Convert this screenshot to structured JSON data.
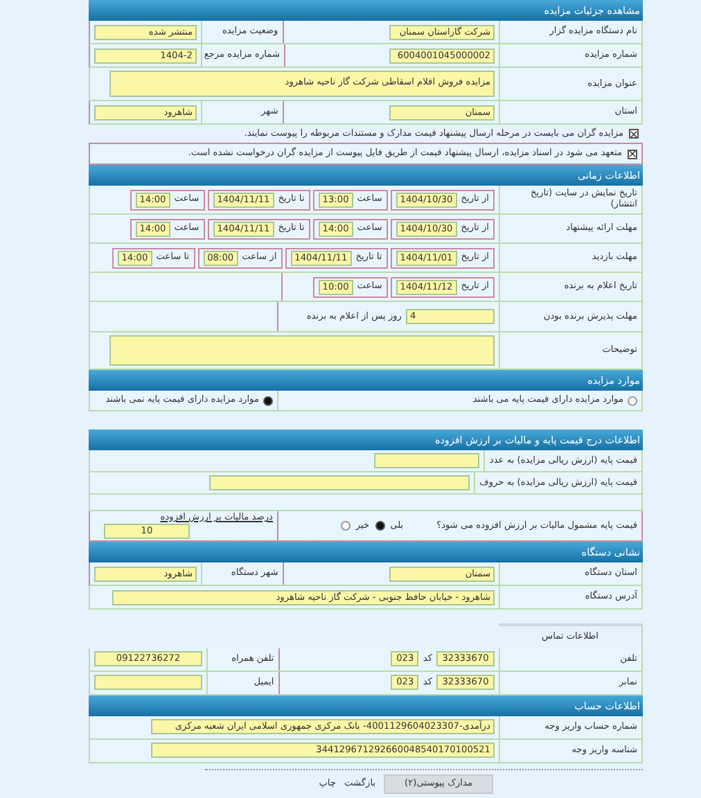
{
  "sections": [
    {
      "kind": "header",
      "title": "مشاهده جزئیات مزایده"
    },
    {
      "kind": "pair",
      "label": "نام دستگاه مزایده گزار",
      "value": "شرکت گازاستان سمنان",
      "label2": "وضعیت مزایده",
      "value2": "منتشر شده"
    },
    {
      "kind": "pair",
      "label": "شماره مزایده",
      "value": "6004001045000002",
      "label2": "شماره مزایده مرجع",
      "value2": "1404-2"
    },
    {
      "kind": "wide",
      "label": "عنوان مزایده",
      "value": "مزایده فروش اقلام اسقاطی شرکت گاز ناحیه شاهرود"
    },
    {
      "kind": "pair",
      "label": "استان",
      "value": "سمنان",
      "label2": "شهر",
      "value2": "شاهرود"
    },
    {
      "kind": "check",
      "checked": true,
      "text": "مزایده گران می بایست در مرحله ارسال پیشنهاد قیمت مدارک و مستندات مربوطه را پیوست نمایند."
    },
    {
      "kind": "note",
      "checked": true,
      "text": "متعهد می شود در اسناد مزایده، ارسال پیشنهاد قیمت از طریق فایل پیوست از مزایده گران درخواست نشده است."
    },
    {
      "kind": "header",
      "title": "اطلاعات زمانی"
    },
    {
      "kind": "times",
      "label": "تاریخ نمایش در سایت (تاریخ انتشار)",
      "items": [
        {
          "label": "از تاریخ",
          "value": "1404/10/30"
        },
        {
          "label": "ساعت",
          "value": "13:00"
        },
        {
          "label": "تا تاریخ",
          "value": "1404/11/11"
        },
        {
          "label": "ساعت",
          "value": "14:00"
        }
      ]
    },
    {
      "kind": "times",
      "label": "مهلت ارائه پیشنهاد",
      "items": [
        {
          "label": "از تاریخ",
          "value": "1404/10/30"
        },
        {
          "label": "ساعت",
          "value": "14:00"
        },
        {
          "label": "تا تاریخ",
          "value": "1404/11/11"
        },
        {
          "label": "ساعت",
          "value": "14:00"
        }
      ]
    },
    {
      "kind": "times",
      "label": "مهلت بازدید",
      "items": [
        {
          "label": "از تاریخ",
          "value": "1404/11/01"
        },
        {
          "label": "تا تاریخ",
          "value": "1404/11/11"
        },
        {
          "label": "از ساعت",
          "value": "08:00"
        },
        {
          "label": "تا ساعت",
          "value": "14:00"
        }
      ]
    },
    {
      "kind": "announce",
      "label": "تاریخ اعلام به برنده",
      "items": [
        {
          "label": "از تاریخ",
          "value": "1404/11/12"
        },
        {
          "label": "ساعت",
          "value": "10:00"
        }
      ]
    },
    {
      "kind": "days",
      "label": "مهلت پذیرش برنده بودن",
      "value": "4",
      "suffix": "روز پس از اعلام به برنده"
    },
    {
      "kind": "wide",
      "label": "توضیحات"
    },
    {
      "kind": "header",
      "title": "موارد مزایده"
    },
    {
      "kind": "radios",
      "options": [
        {
          "text": "موارد مزایده دارای قیمت پایه می باشند",
          "selected": false
        },
        {
          "text": "موارد مزایده دارای قیمت پایه نمی باشند",
          "selected": true
        }
      ]
    },
    {
      "kind": "header",
      "title": "اطلاعات درج قیمت پایه و مالیات بر ارزش افزوده"
    },
    {
      "kind": "short",
      "label": "قیمت پایه (ارزش ریالی مزایده) به عدد"
    },
    {
      "kind": "long",
      "label": "قیمت پایه (ارزش ریالی مزایده) به حروف"
    },
    {
      "kind": "vat",
      "label": "قیمت پایه مشمول مالیات بر ارزش افزوده می شود؟",
      "options": [
        {
          "text": "بلی",
          "selected": true
        },
        {
          "text": "خیر",
          "selected": false
        }
      ],
      "rate_label": "درصد مالیات بر ارزش افزوده",
      "rate": "10"
    },
    {
      "kind": "header",
      "title": "نشانی دستگاه"
    },
    {
      "kind": "pair",
      "label": "استان دستگاه",
      "value": "سمنان",
      "label2": "شهر دستگاه",
      "value2": "شاهرود"
    },
    {
      "kind": "wide",
      "label": "آدرس دستگاه",
      "value": "شاهرود - خیابان حافظ جنوبی - شرکت گاز ناحیه شاهرود"
    },
    {
      "kind": "subhead",
      "title": "اطلاعات تماس"
    },
    {
      "kind": "phone",
      "label": "تلفن",
      "number": "32333670",
      "code_label": "کد",
      "code": "023",
      "label2": "تلفن همراه",
      "value2": "09122736272"
    },
    {
      "kind": "phone",
      "label": "نمابر",
      "number": "32333670",
      "code_label": "کد",
      "code": "023",
      "label2": "ایمیل"
    },
    {
      "kind": "header",
      "title": "اطلاعات حساب"
    },
    {
      "kind": "account",
      "label": "شماره حساب واریز وجه",
      "value": "درآمدی-4001129604023307- بانک مرکزی جمهوری اسلامی ایران شعبه مرکزی"
    },
    {
      "kind": "account",
      "label": "شناسه واریز وجه",
      "value": "344129671292660048540170100521"
    }
  ],
  "buttons": [
    {
      "kind": "button",
      "label": "مدارک پیوستی(۲)"
    },
    {
      "kind": "link",
      "label": "بازگشت"
    },
    {
      "kind": "link",
      "label": "چاپ"
    }
  ]
}
